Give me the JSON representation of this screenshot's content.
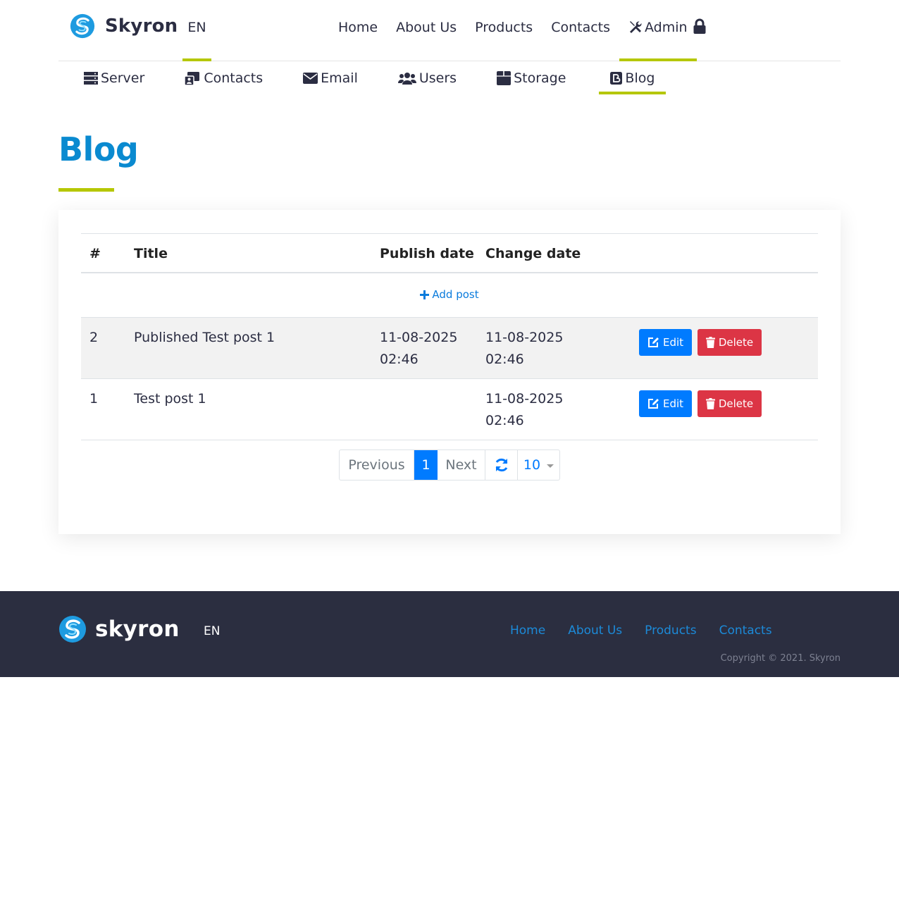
{
  "header": {
    "brand": "Skyron",
    "lang": "EN",
    "nav": [
      "Home",
      "About Us",
      "Products",
      "Contacts"
    ],
    "admin_label": "Admin",
    "lock_icon": "lock-icon"
  },
  "subnav": {
    "items": [
      {
        "label": "Server",
        "icon": "server-icon"
      },
      {
        "label": "Contacts",
        "icon": "contacts-icon"
      },
      {
        "label": "Email",
        "icon": "envelope-icon"
      },
      {
        "label": "Users",
        "icon": "users-icon"
      },
      {
        "label": "Storage",
        "icon": "archive-icon"
      },
      {
        "label": "Blog",
        "icon": "blog-icon"
      }
    ],
    "active": "Blog"
  },
  "page": {
    "title": "Blog"
  },
  "table": {
    "headers": [
      "#",
      "Title",
      "Publish date",
      "Change date"
    ],
    "add_label": "Add post",
    "rows": [
      {
        "id": "2",
        "title": "Published Test post 1",
        "publish_date": "11-08-2025",
        "publish_time": "02:46",
        "change_date": "11-08-2025",
        "change_time": "02:46"
      },
      {
        "id": "1",
        "title": "Test post 1",
        "publish_date": "",
        "publish_time": "",
        "change_date": "11-08-2025",
        "change_time": "02:46"
      }
    ],
    "edit_label": "Edit",
    "delete_label": "Delete"
  },
  "pagination": {
    "previous": "Previous",
    "current": "1",
    "next": "Next",
    "page_size": "10"
  },
  "footer": {
    "brand": "skyron",
    "lang": "EN",
    "nav": [
      "Home",
      "About Us",
      "Products",
      "Contacts"
    ],
    "copyright": "Copyright © 2021. Skyron"
  },
  "colors": {
    "accent": "#b5c700",
    "title_blue": "#0a8ad0",
    "primary": "#007bff",
    "danger": "#dc3545",
    "footer_bg": "#2b2e40"
  }
}
